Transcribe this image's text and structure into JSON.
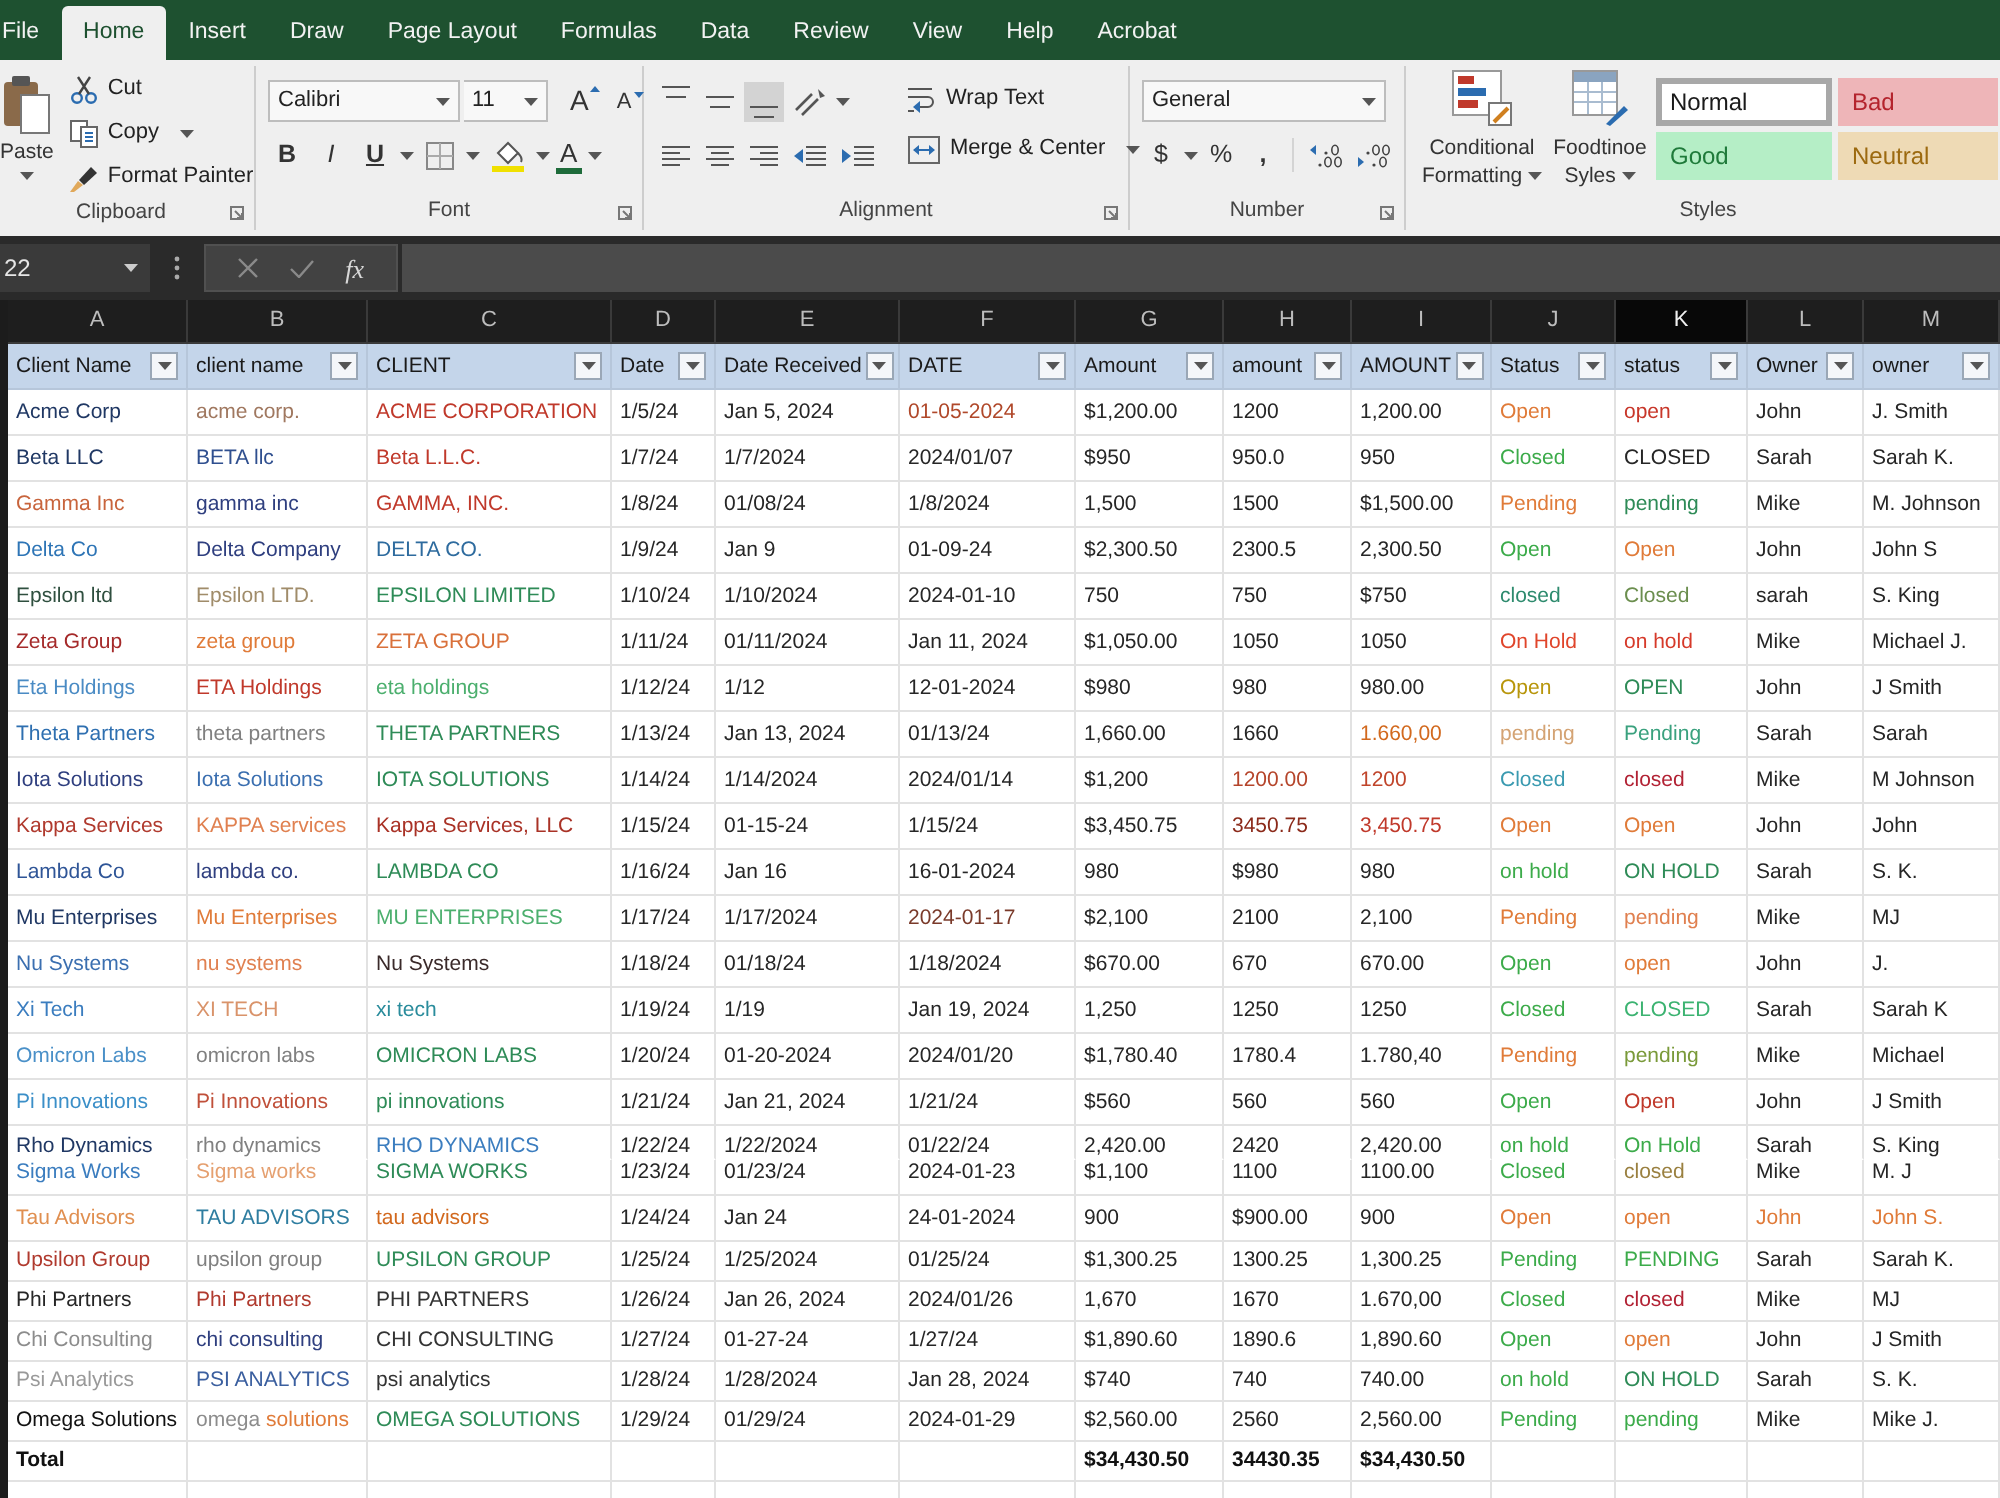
{
  "tabs": [
    {
      "label": "File",
      "selected": false
    },
    {
      "label": "Home",
      "selected": true
    },
    {
      "label": "Insert",
      "selected": false
    },
    {
      "label": "Draw",
      "selected": false
    },
    {
      "label": "Page Layout",
      "selected": false
    },
    {
      "label": "Formulas",
      "selected": false
    },
    {
      "label": "Data",
      "selected": false
    },
    {
      "label": "Review",
      "selected": false
    },
    {
      "label": "View",
      "selected": false
    },
    {
      "label": "Help",
      "selected": false
    },
    {
      "label": "Acrobat",
      "selected": false
    }
  ],
  "ribbon": {
    "clipboard": {
      "paste": "Paste",
      "cut": "Cut",
      "copy": "Copy",
      "format_painter": "Format Painter",
      "label": "Clipboard"
    },
    "font": {
      "font_name": "Calibri",
      "font_size": "11",
      "grow": "A",
      "shrink": "A",
      "bold": "B",
      "italic": "I",
      "underline": "U",
      "font_color": "A",
      "label": "Font"
    },
    "alignment": {
      "vertical_align": [
        {
          "selected": false
        },
        {
          "selected": false
        },
        {
          "selected": true
        }
      ],
      "wrap_text": "Wrap Text",
      "merge": "Merge & Center",
      "label": "Alignment"
    },
    "number": {
      "format": "General",
      "currency": "$",
      "percent": "%",
      "comma": ",",
      "label": "Number"
    },
    "styles": {
      "conditional_formatting": "Conditional Formatting",
      "format_table": "Foodtinoe Syles",
      "items": [
        {
          "label": "Normal",
          "selected": true,
          "color": "#1a1a1a"
        },
        {
          "label": "Bad",
          "selected": false,
          "color": "#b4242d"
        },
        {
          "label": "Good",
          "selected": false,
          "color": "#1f7a3a"
        },
        {
          "label": "Neutral",
          "selected": false,
          "color": "#9c6a10"
        }
      ],
      "label": "Styles"
    }
  },
  "formula_bar": {
    "name_box": "22",
    "function": "fx"
  },
  "sheet": {
    "column_letters": [
      {
        "letter": "A",
        "selected": false
      },
      {
        "letter": "B",
        "selected": false
      },
      {
        "letter": "C",
        "selected": false
      },
      {
        "letter": "D",
        "selected": false
      },
      {
        "letter": "E",
        "selected": false
      },
      {
        "letter": "F",
        "selected": false
      },
      {
        "letter": "G",
        "selected": false
      },
      {
        "letter": "H",
        "selected": false
      },
      {
        "letter": "I",
        "selected": false
      },
      {
        "letter": "J",
        "selected": false
      },
      {
        "letter": "K",
        "selected": true
      },
      {
        "letter": "L",
        "selected": false
      },
      {
        "letter": "M",
        "selected": false
      }
    ]
  },
  "table": {
    "columns": [
      "Client Name",
      "client name",
      "CLIENT",
      "Date",
      "Date Received",
      "DATE",
      "Amount",
      "amount",
      "AMOUNT",
      "Status",
      "status",
      "Owner",
      "owner"
    ],
    "rows": [
      {
        "kind": "single",
        "cells": [
          {
            "text": "Acme Corp",
            "color": "#203864"
          },
          {
            "text": "acme corp.",
            "color": "#a07860"
          },
          {
            "text": "ACME CORPORATION",
            "color": "#c0392b"
          },
          {
            "text": "1/5/24",
            "color": "#262626"
          },
          {
            "text": "Jan 5, 2024",
            "color": "#262626"
          },
          {
            "text": "01-05-2024",
            "color": "#b0482a"
          },
          {
            "text": "$1,200.00",
            "color": "#262626"
          },
          {
            "text": "1200",
            "color": "#262626"
          },
          {
            "text": "1,200.00",
            "color": "#262626"
          },
          {
            "text": "Open",
            "color": "#e07b39"
          },
          {
            "text": "open",
            "color": "#c8372a"
          },
          {
            "text": "John",
            "color": "#262626"
          },
          {
            "text": "J. Smith",
            "color": "#262626"
          }
        ]
      },
      {
        "kind": "single",
        "cells": [
          {
            "text": "Beta LLC",
            "color": "#203864"
          },
          {
            "text": "BETA llc",
            "color": "#2f4f8f"
          },
          {
            "text": "Beta L.L.C.",
            "color": "#c0392b"
          },
          {
            "text": "1/7/24",
            "color": "#262626"
          },
          {
            "text": "1/7/2024",
            "color": "#262626"
          },
          {
            "text": "2024/01/07",
            "color": "#262626"
          },
          {
            "text": "$950",
            "color": "#262626"
          },
          {
            "text": "950.0",
            "color": "#262626"
          },
          {
            "text": "950",
            "color": "#262626"
          },
          {
            "text": "Closed",
            "color": "#3cab4a"
          },
          {
            "text": "CLOSED",
            "color": "#262626"
          },
          {
            "text": "Sarah",
            "color": "#262626"
          },
          {
            "text": "Sarah K.",
            "color": "#262626"
          }
        ]
      },
      {
        "kind": "single",
        "cells": [
          {
            "text": "Gamma Inc",
            "color": "#c8643c"
          },
          {
            "text": "gamma inc",
            "color": "#2f3f7f"
          },
          {
            "text": "GAMMA, INC.",
            "color": "#c0392b"
          },
          {
            "text": "1/8/24",
            "color": "#262626"
          },
          {
            "text": "01/08/24",
            "color": "#262626"
          },
          {
            "text": "1/8/2024",
            "color": "#262626"
          },
          {
            "text": "1,500",
            "color": "#262626"
          },
          {
            "text": "1500",
            "color": "#262626"
          },
          {
            "text": "$1,500.00",
            "color": "#262626"
          },
          {
            "text": "Pending",
            "color": "#e07b39"
          },
          {
            "text": "pending",
            "color": "#2e8b57"
          },
          {
            "text": "Mike",
            "color": "#262626"
          },
          {
            "text": "M. Johnson",
            "color": "#262626"
          }
        ]
      },
      {
        "kind": "single",
        "cells": [
          {
            "text": "Delta Co",
            "color": "#2e75b6"
          },
          {
            "text": "Delta Company",
            "color": "#2f3f7f"
          },
          {
            "text": "DELTA CO.",
            "color": "#2e6b9e"
          },
          {
            "text": "1/9/24",
            "color": "#262626"
          },
          {
            "text": "Jan 9",
            "color": "#262626"
          },
          {
            "text": "01-09-24",
            "color": "#262626"
          },
          {
            "text": "$2,300.50",
            "color": "#262626"
          },
          {
            "text": "2300.5",
            "color": "#262626"
          },
          {
            "text": "2,300.50",
            "color": "#262626"
          },
          {
            "text": "Open",
            "color": "#3cab4a"
          },
          {
            "text": "Open",
            "color": "#e07b39"
          },
          {
            "text": "John",
            "color": "#262626"
          },
          {
            "text": "John S",
            "color": "#262626"
          }
        ]
      },
      {
        "kind": "single",
        "cells": [
          {
            "text": "Epsilon ltd",
            "color": "#2f4f3f"
          },
          {
            "text": "Epsilon LTD.",
            "color": "#a08c6a"
          },
          {
            "text": "EPSILON LIMITED",
            "color": "#2e8b57"
          },
          {
            "text": "1/10/24",
            "color": "#262626"
          },
          {
            "text": "1/10/2024",
            "color": "#262626"
          },
          {
            "text": "2024-01-10",
            "color": "#262626"
          },
          {
            "text": "750",
            "color": "#262626"
          },
          {
            "text": "750",
            "color": "#262626"
          },
          {
            "text": "$750",
            "color": "#262626"
          },
          {
            "text": "closed",
            "color": "#2e8b6e"
          },
          {
            "text": "Closed",
            "color": "#6b8e4e"
          },
          {
            "text": "sarah",
            "color": "#262626"
          },
          {
            "text": "S. King",
            "color": "#262626"
          }
        ]
      },
      {
        "kind": "single",
        "cells": [
          {
            "text": "Zeta Group",
            "color": "#a52a2a"
          },
          {
            "text": "zeta group",
            "color": "#e07b39"
          },
          {
            "text": "ZETA GROUP",
            "color": "#d9703a"
          },
          {
            "text": "1/11/24",
            "color": "#262626"
          },
          {
            "text": "01/11/2024",
            "color": "#262626"
          },
          {
            "text": "Jan 11, 2024",
            "color": "#262626"
          },
          {
            "text": "$1,050.00",
            "color": "#262626"
          },
          {
            "text": "1050",
            "color": "#262626"
          },
          {
            "text": "1050",
            "color": "#262626"
          },
          {
            "text": "On Hold",
            "color": "#e0452b"
          },
          {
            "text": "on hold",
            "color": "#d63a2a"
          },
          {
            "text": "Mike",
            "color": "#262626"
          },
          {
            "text": "Michael J.",
            "color": "#262626"
          }
        ]
      },
      {
        "kind": "single",
        "cells": [
          {
            "text": "Eta Holdings",
            "color": "#4a8bc4"
          },
          {
            "text": "ETA Holdings",
            "color": "#c0392b"
          },
          {
            "text": "eta holdings",
            "color": "#4caf6e"
          },
          {
            "text": "1/12/24",
            "color": "#262626"
          },
          {
            "text": "1/12",
            "color": "#262626"
          },
          {
            "text": "12-01-2024",
            "color": "#262626"
          },
          {
            "text": "$980",
            "color": "#262626"
          },
          {
            "text": "980",
            "color": "#262626"
          },
          {
            "text": "980.00",
            "color": "#262626"
          },
          {
            "text": "Open",
            "color": "#b8960c"
          },
          {
            "text": "OPEN",
            "color": "#2e8b57"
          },
          {
            "text": "John",
            "color": "#262626"
          },
          {
            "text": "J Smith",
            "color": "#262626"
          }
        ]
      },
      {
        "kind": "single",
        "cells": [
          {
            "text": "Theta Partners",
            "color": "#2e6fb0"
          },
          {
            "text": "theta partners",
            "color": "#808080"
          },
          {
            "text": "THETA PARTNERS",
            "color": "#2e8b57"
          },
          {
            "text": "1/13/24",
            "color": "#262626"
          },
          {
            "text": "Jan 13, 2024",
            "color": "#262626"
          },
          {
            "text": "01/13/24",
            "color": "#262626"
          },
          {
            "text": "1,660.00",
            "color": "#262626"
          },
          {
            "text": "1660",
            "color": "#262626"
          },
          {
            "text": "1.660,00",
            "color": "#d2691e"
          },
          {
            "text": "pending",
            "color": "#d4a373"
          },
          {
            "text": "Pending",
            "color": "#3aa17e"
          },
          {
            "text": "Sarah",
            "color": "#262626"
          },
          {
            "text": "Sarah",
            "color": "#262626"
          }
        ]
      },
      {
        "kind": "single",
        "cells": [
          {
            "text": "Iota Solutions",
            "color": "#2f3f7f"
          },
          {
            "text": "Iota Solutions",
            "color": "#3b6fb0"
          },
          {
            "text": "IOTA SOLUTIONS",
            "color": "#2e8b57"
          },
          {
            "text": "1/14/24",
            "color": "#262626"
          },
          {
            "text": "1/14/2024",
            "color": "#262626"
          },
          {
            "text": "2024/01/14",
            "color": "#262626"
          },
          {
            "text": "$1,200",
            "color": "#262626"
          },
          {
            "text": "1200.00",
            "color": "#b5452b"
          },
          {
            "text": "1200",
            "color": "#c0452b"
          },
          {
            "text": "Closed",
            "color": "#3a9ab0"
          },
          {
            "text": "closed",
            "color": "#b22234"
          },
          {
            "text": "Mike",
            "color": "#262626"
          },
          {
            "text": "M Johnson",
            "color": "#262626"
          }
        ]
      },
      {
        "kind": "single",
        "cells": [
          {
            "text": "Kappa Services",
            "color": "#b03a2e"
          },
          {
            "text": "KAPPA services",
            "color": "#e08050"
          },
          {
            "text": "Kappa Services, LLC",
            "color": "#a93226"
          },
          {
            "text": "1/15/24",
            "color": "#262626"
          },
          {
            "text": "01-15-24",
            "color": "#262626"
          },
          {
            "text": "1/15/24",
            "color": "#262626"
          },
          {
            "text": "$3,450.75",
            "color": "#262626"
          },
          {
            "text": "3450.75",
            "color": "#8b2a1a"
          },
          {
            "text": "3,450.75",
            "color": "#c0392b"
          },
          {
            "text": "Open",
            "color": "#e07b39"
          },
          {
            "text": "Open",
            "color": "#e07b39"
          },
          {
            "text": "John",
            "color": "#262626"
          },
          {
            "text": "John",
            "color": "#262626"
          }
        ]
      },
      {
        "kind": "single",
        "cells": [
          {
            "text": "Lambda Co",
            "color": "#2f5597"
          },
          {
            "text": "lambda co.",
            "color": "#2f3f7f"
          },
          {
            "text": "LAMBDA CO",
            "color": "#2e8b57"
          },
          {
            "text": "1/16/24",
            "color": "#262626"
          },
          {
            "text": "Jan 16",
            "color": "#262626"
          },
          {
            "text": "16-01-2024",
            "color": "#262626"
          },
          {
            "text": "980",
            "color": "#262626"
          },
          {
            "text": "$980",
            "color": "#262626"
          },
          {
            "text": "980",
            "color": "#262626"
          },
          {
            "text": "on hold",
            "color": "#3cab4a"
          },
          {
            "text": "ON HOLD",
            "color": "#2e8b57"
          },
          {
            "text": "Sarah",
            "color": "#262626"
          },
          {
            "text": "S. K.",
            "color": "#262626"
          }
        ]
      },
      {
        "kind": "single",
        "cells": [
          {
            "text": "Mu Enterprises",
            "color": "#203864"
          },
          {
            "text": "Mu Enterprises",
            "color": "#e07b39"
          },
          {
            "text": "MU ENTERPRISES",
            "color": "#4caf6e"
          },
          {
            "text": "1/17/24",
            "color": "#262626"
          },
          {
            "text": "1/17/2024",
            "color": "#262626"
          },
          {
            "text": "2024-01-17",
            "color": "#7a3a2a"
          },
          {
            "text": "$2,100",
            "color": "#262626"
          },
          {
            "text": "2100",
            "color": "#262626"
          },
          {
            "text": "2,100",
            "color": "#262626"
          },
          {
            "text": "Pending",
            "color": "#e07b39"
          },
          {
            "text": "pending",
            "color": "#e08050"
          },
          {
            "text": "Mike",
            "color": "#262626"
          },
          {
            "text": "MJ",
            "color": "#262626"
          }
        ]
      },
      {
        "kind": "single",
        "cells": [
          {
            "text": "Nu Systems",
            "color": "#3b6fb0"
          },
          {
            "text": "nu systems",
            "color": "#e08050"
          },
          {
            "text": "Nu Systems",
            "color": "#3a2a2a"
          },
          {
            "text": "1/18/24",
            "color": "#262626"
          },
          {
            "text": "01/18/24",
            "color": "#262626"
          },
          {
            "text": "1/18/2024",
            "color": "#262626"
          },
          {
            "text": "$670.00",
            "color": "#262626"
          },
          {
            "text": "670",
            "color": "#262626"
          },
          {
            "text": "670.00",
            "color": "#262626"
          },
          {
            "text": "Open",
            "color": "#3cab4a"
          },
          {
            "text": "open",
            "color": "#e07b39"
          },
          {
            "text": "John",
            "color": "#262626"
          },
          {
            "text": "J.",
            "color": "#262626"
          }
        ]
      },
      {
        "kind": "single",
        "cells": [
          {
            "text": "Xi Tech",
            "color": "#3b7dbf"
          },
          {
            "text": "XI TECH",
            "color": "#d9936a"
          },
          {
            "text": "xi tech",
            "color": "#2a8c9c"
          },
          {
            "text": "1/19/24",
            "color": "#262626"
          },
          {
            "text": "1/19",
            "color": "#262626"
          },
          {
            "text": "Jan 19, 2024",
            "color": "#262626"
          },
          {
            "text": "1,250",
            "color": "#262626"
          },
          {
            "text": "1250",
            "color": "#262626"
          },
          {
            "text": "1250",
            "color": "#262626"
          },
          {
            "text": "Closed",
            "color": "#3cab4a"
          },
          {
            "text": "CLOSED",
            "color": "#3cb371"
          },
          {
            "text": "Sarah",
            "color": "#262626"
          },
          {
            "text": "Sarah K",
            "color": "#262626"
          }
        ]
      },
      {
        "kind": "single",
        "cells": [
          {
            "text": "Omicron Labs",
            "color": "#4a90c8"
          },
          {
            "text": "omicron labs",
            "color": "#808080"
          },
          {
            "text": "OMICRON LABS",
            "color": "#2e8b57"
          },
          {
            "text": "1/20/24",
            "color": "#262626"
          },
          {
            "text": "01-20-2024",
            "color": "#262626"
          },
          {
            "text": "2024/01/20",
            "color": "#262626"
          },
          {
            "text": "$1,780.40",
            "color": "#262626"
          },
          {
            "text": "1780.4",
            "color": "#262626"
          },
          {
            "text": "1.780,40",
            "color": "#262626"
          },
          {
            "text": "Pending",
            "color": "#e07b39"
          },
          {
            "text": "pending",
            "color": "#7a9a3a"
          },
          {
            "text": "Mike",
            "color": "#262626"
          },
          {
            "text": "Michael",
            "color": "#262626"
          }
        ]
      },
      {
        "kind": "single",
        "cells": [
          {
            "text": "Pi Innovations",
            "color": "#3b8fc8"
          },
          {
            "text": "Pi Innovations",
            "color": "#c0503a"
          },
          {
            "text": "pi innovations",
            "color": "#2e8b57"
          },
          {
            "text": "1/21/24",
            "color": "#262626"
          },
          {
            "text": "Jan 21, 2024",
            "color": "#262626"
          },
          {
            "text": "1/21/24",
            "color": "#262626"
          },
          {
            "text": "$560",
            "color": "#262626"
          },
          {
            "text": "560",
            "color": "#262626"
          },
          {
            "text": "560",
            "color": "#262626"
          },
          {
            "text": "Open",
            "color": "#3cab4a"
          },
          {
            "text": "Open",
            "color": "#c0392b"
          },
          {
            "text": "John",
            "color": "#262626"
          },
          {
            "text": "J Smith",
            "color": "#262626"
          }
        ]
      },
      {
        "kind": "upper",
        "cells": [
          {
            "text": "Rho Dynamics",
            "color": "#203864"
          },
          {
            "text": "rho dynamics",
            "color": "#808080"
          },
          {
            "text": "RHO DYNAMICS",
            "color": "#3b7dbf"
          },
          {
            "text": "1/22/24",
            "color": "#262626"
          },
          {
            "text": "1/22/2024",
            "color": "#262626"
          },
          {
            "text": "01/22/24",
            "color": "#262626"
          },
          {
            "text": "2,420.00",
            "color": "#262626"
          },
          {
            "text": "2420",
            "color": "#262626"
          },
          {
            "text": "2,420.00",
            "color": "#262626"
          },
          {
            "text": "on hold",
            "color": "#3cab4a"
          },
          {
            "text": "On Hold",
            "color": "#3cab4a"
          },
          {
            "text": "Sarah",
            "color": "#262626"
          },
          {
            "text": "S. King",
            "color": "#262626"
          }
        ]
      },
      {
        "kind": "lower",
        "cells": [
          {
            "text": "Sigma Works",
            "color": "#3b7dbf"
          },
          {
            "text": "Sigma works",
            "color": "#e5a070"
          },
          {
            "text": "SIGMA WORKS",
            "color": "#2e8b57"
          },
          {
            "text": "1/23/24",
            "color": "#262626"
          },
          {
            "text": "01/23/24",
            "color": "#262626"
          },
          {
            "text": "2024-01-23",
            "color": "#262626"
          },
          {
            "text": "$1,100",
            "color": "#262626"
          },
          {
            "text": "1100",
            "color": "#262626"
          },
          {
            "text": "1100.00",
            "color": "#262626"
          },
          {
            "text": "Closed",
            "color": "#3cab4a"
          },
          {
            "text": "closed",
            "color": "#9a8040"
          },
          {
            "text": "Mike",
            "color": "#262626"
          },
          {
            "text": "M. J",
            "color": "#262626"
          }
        ]
      },
      {
        "kind": "single",
        "cells": [
          {
            "text": "Tau Advisors",
            "color": "#e08f50"
          },
          {
            "text": "TAU ADVISORS",
            "color": "#2e7da0"
          },
          {
            "text": "tau advisors",
            "color": "#d2691e"
          },
          {
            "text": "1/24/24",
            "color": "#262626"
          },
          {
            "text": "Jan 24",
            "color": "#262626"
          },
          {
            "text": "24-01-2024",
            "color": "#262626"
          },
          {
            "text": "900",
            "color": "#262626"
          },
          {
            "text": "$900.00",
            "color": "#262626"
          },
          {
            "text": "900",
            "color": "#262626"
          },
          {
            "text": "Open",
            "color": "#e07b39"
          },
          {
            "text": "open",
            "color": "#e07b39"
          },
          {
            "text": "John",
            "color": "#e07b39"
          },
          {
            "text": "John S.",
            "color": "#e07b39"
          }
        ]
      },
      {
        "kind": "short",
        "cells": [
          {
            "text": "Upsilon Group",
            "color": "#b03a2e"
          },
          {
            "text": "upsilon group",
            "color": "#808080"
          },
          {
            "text": "UPSILON GROUP",
            "color": "#2e8b57"
          },
          {
            "text": "1/25/24",
            "color": "#262626"
          },
          {
            "text": "1/25/2024",
            "color": "#262626"
          },
          {
            "text": "01/25/24",
            "color": "#262626"
          },
          {
            "text": "$1,300.25",
            "color": "#262626"
          },
          {
            "text": "1300.25",
            "color": "#262626"
          },
          {
            "text": "1,300.25",
            "color": "#262626"
          },
          {
            "text": "Pending",
            "color": "#3cab4a"
          },
          {
            "text": "PENDING",
            "color": "#3cab4a"
          },
          {
            "text": "Sarah",
            "color": "#262626"
          },
          {
            "text": "Sarah K.",
            "color": "#262626"
          }
        ]
      },
      {
        "kind": "short",
        "cells": [
          {
            "text": "Phi Partners",
            "color": "#262626"
          },
          {
            "text": "Phi Partners",
            "color": "#b03a2e"
          },
          {
            "text": "PHI PARTNERS",
            "color": "#333333"
          },
          {
            "text": "1/26/24",
            "color": "#262626"
          },
          {
            "text": "Jan 26, 2024",
            "color": "#262626"
          },
          {
            "text": "2024/01/26",
            "color": "#262626"
          },
          {
            "text": "1,670",
            "color": "#262626"
          },
          {
            "text": "1670",
            "color": "#262626"
          },
          {
            "text": "1.670,00",
            "color": "#262626"
          },
          {
            "text": "Closed",
            "color": "#3cab4a"
          },
          {
            "text": "closed",
            "color": "#b22234"
          },
          {
            "text": "Mike",
            "color": "#262626"
          },
          {
            "text": "MJ",
            "color": "#262626"
          }
        ]
      },
      {
        "kind": "short",
        "cells": [
          {
            "text": "Chi Consulting",
            "color": "#8c8c8c"
          },
          {
            "text": "chi consulting",
            "color": "#2f3f7f"
          },
          {
            "text": "CHI CONSULTING",
            "color": "#333333"
          },
          {
            "text": "1/27/24",
            "color": "#262626"
          },
          {
            "text": "01-27-24",
            "color": "#262626"
          },
          {
            "text": "1/27/24",
            "color": "#262626"
          },
          {
            "text": "$1,890.60",
            "color": "#262626"
          },
          {
            "text": "1890.6",
            "color": "#262626"
          },
          {
            "text": "1,890.60",
            "color": "#262626"
          },
          {
            "text": "Open",
            "color": "#3cab4a"
          },
          {
            "text": "open",
            "color": "#e07b39"
          },
          {
            "text": "John",
            "color": "#262626"
          },
          {
            "text": "J Smith",
            "color": "#262626"
          }
        ]
      },
      {
        "kind": "short",
        "cells": [
          {
            "text": "Psi Analytics",
            "color": "#999999"
          },
          {
            "text": "PSI ANALYTICS",
            "color": "#3b5f9f"
          },
          {
            "text": "psi analytics",
            "color": "#333333"
          },
          {
            "text": "1/28/24",
            "color": "#262626"
          },
          {
            "text": "1/28/2024",
            "color": "#262626"
          },
          {
            "text": "Jan 28, 2024",
            "color": "#262626"
          },
          {
            "text": "$740",
            "color": "#262626"
          },
          {
            "text": "740",
            "color": "#262626"
          },
          {
            "text": "740.00",
            "color": "#262626"
          },
          {
            "text": "on hold",
            "color": "#3cab4a"
          },
          {
            "text": "ON HOLD",
            "color": "#2e8b57"
          },
          {
            "text": "Sarah",
            "color": "#262626"
          },
          {
            "text": "S. K.",
            "color": "#262626"
          }
        ]
      },
      {
        "kind": "short",
        "cells": [
          {
            "text": "Omega Solutions",
            "color": "#111111"
          },
          {
            "parts": [
              {
                "text": "omega",
                "color": "#8c8c8c"
              },
              {
                "text": "solutions",
                "color": "#e07b39"
              }
            ]
          },
          {
            "text": "OMEGA SOLUTIONS",
            "color": "#2e8b57"
          },
          {
            "text": "1/29/24",
            "color": "#262626"
          },
          {
            "text": "01/29/24",
            "color": "#262626"
          },
          {
            "text": "2024-01-29",
            "color": "#262626"
          },
          {
            "text": "$2,560.00",
            "color": "#262626"
          },
          {
            "text": "2560",
            "color": "#262626"
          },
          {
            "text": "2,560.00",
            "color": "#262626"
          },
          {
            "text": "Pending",
            "color": "#3cab4a"
          },
          {
            "text": "pending",
            "color": "#3cab4a"
          },
          {
            "text": "Mike",
            "color": "#262626"
          },
          {
            "text": "Mike J.",
            "color": "#262626"
          }
        ]
      }
    ],
    "total_row": {
      "label": "Total",
      "sums": [
        "$34,430.50",
        "34430.35",
        "$34,430.50"
      ]
    }
  }
}
